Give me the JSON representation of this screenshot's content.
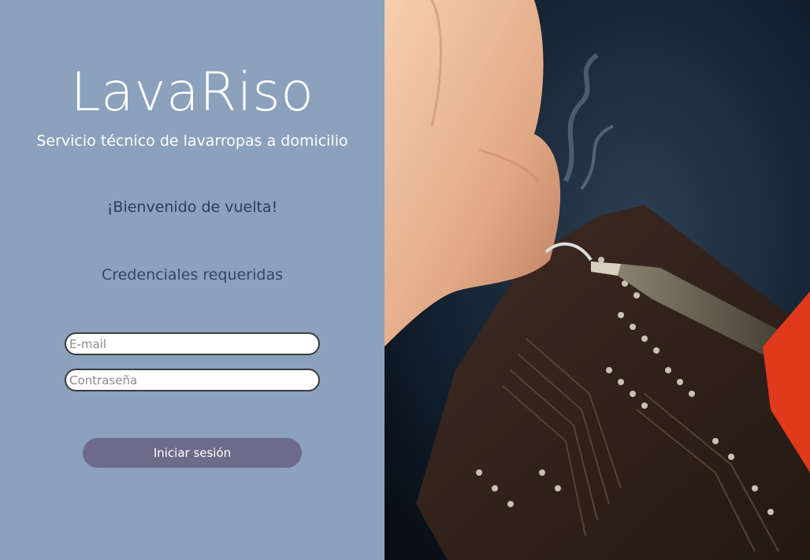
{
  "brand": {
    "name": "LavaRiso",
    "tagline": "Servicio técnico de lavarropas a domicilio"
  },
  "login": {
    "welcome": "¡Bienvenido de vuelta!",
    "credentials_title": "Credenciales requeridas",
    "email_placeholder": "E-mail",
    "password_placeholder": "Contraseña",
    "submit_label": "Iniciar sesión"
  },
  "colors": {
    "panel_bg": "#8ba1bc",
    "button_bg": "#6d6a8a",
    "heading_dark": "#2b3d5c"
  },
  "hero_image": {
    "subject": "soldering-circuit-board-photo"
  }
}
